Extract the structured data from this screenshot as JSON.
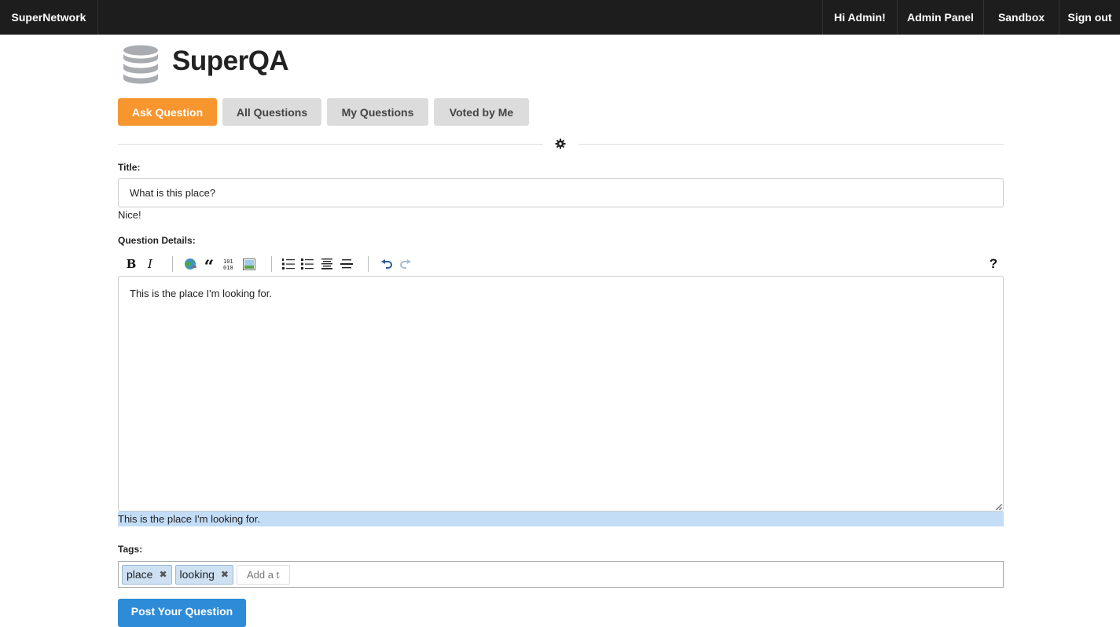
{
  "navbar": {
    "brand": "SuperNetwork",
    "items": [
      "Hi Admin!",
      "Admin Panel",
      "Sandbox",
      "Sign out"
    ]
  },
  "header": {
    "title": "SuperQA",
    "logo_icon": "database-icon"
  },
  "tabs": [
    {
      "label": "Ask Question",
      "active": true
    },
    {
      "label": "All Questions",
      "active": false
    },
    {
      "label": "My Questions",
      "active": false
    },
    {
      "label": "Voted by Me",
      "active": false
    }
  ],
  "form": {
    "title_label": "Title:",
    "title_value": "What is this place?",
    "title_feedback": "Nice!",
    "details_label": "Question Details:",
    "details_value": "This is the place I'm looking for.",
    "preview_text": "This is the place I'm looking for.",
    "help_symbol": "?",
    "tags_label": "Tags:",
    "tags": [
      "place",
      "looking"
    ],
    "tag_remove_symbol": "✖",
    "tag_placeholder": "Add a tag",
    "submit_label": "Post Your Question"
  },
  "toolbar": {
    "bold": "B",
    "italic": "I",
    "quote": "“",
    "code": "101\n010"
  },
  "colors": {
    "navbar_bg": "#1d1d1d",
    "accent_orange": "#f7952e",
    "primary_blue": "#2e8bd8",
    "preview_highlight": "#c3ddf7",
    "tag_bg": "#cde1f3"
  }
}
